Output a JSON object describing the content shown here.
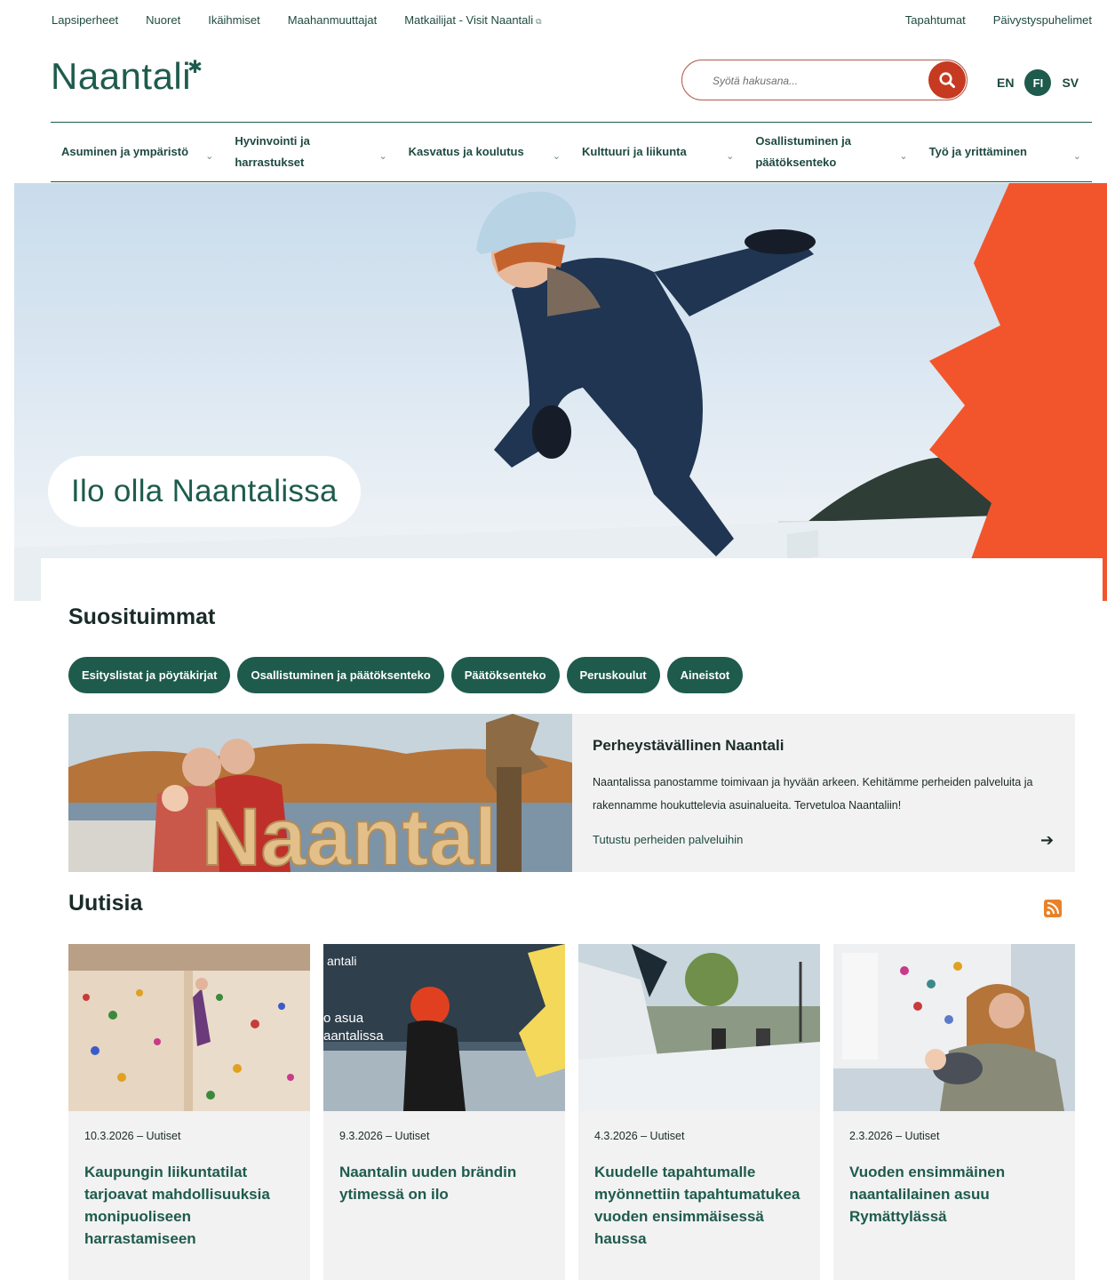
{
  "topnav": {
    "left": [
      "Lapsiperheet",
      "Nuoret",
      "Ikäihmiset",
      "Maahanmuuttajat",
      "Matkailijat - Visit Naantali"
    ],
    "right": [
      "Tapahtumat",
      "Päivystyspuhelimet"
    ]
  },
  "header": {
    "logo": "Naantali",
    "search_placeholder": "Syötä hakusana...",
    "languages": [
      "EN",
      "FI",
      "SV"
    ],
    "active_language": "FI"
  },
  "mainnav": [
    "Asuminen ja ympäristö",
    "Hyvinvointi ja harrastukset",
    "Kasvatus ja koulutus",
    "Kulttuuri ja liikunta",
    "Osallistuminen ja päätöksenteko",
    "Työ ja yrittäminen"
  ],
  "hero": {
    "caption": "Ilo olla Naantalissa"
  },
  "popular": {
    "title": "Suosituimmat",
    "pills": [
      "Esityslistat ja pöytäkirjat",
      "Osallistuminen ja päätöksenteko",
      "Päätöksenteko",
      "Peruskoulut",
      "Aineistot"
    ]
  },
  "feature": {
    "title": "Perheystävällinen Naantali",
    "text": "Naantalissa panostamme toimivaan ja hyvään arkeen. Kehitämme perheiden palveluita ja rakennamme houkuttelevia asuinalueita. Tervetuloa Naantaliin!",
    "link": "Tutustu perheiden palveluihin",
    "image_sign": "Naantali"
  },
  "news": {
    "title": "Uutisia",
    "items": [
      {
        "meta": "10.3.2026 – Uutiset",
        "title": "Kaupungin liikuntatilat tarjoavat mahdollisuuksia monipuoliseen harrastamiseen"
      },
      {
        "meta": "9.3.2026 – Uutiset",
        "title": "Naantalin uuden brändin ytimessä on ilo",
        "overlay": [
          "antali",
          "o asua",
          "aantalissa"
        ]
      },
      {
        "meta": "4.3.2026 – Uutiset",
        "title": "Kuudelle tapahtumalle myönnettiin tapahtumatukea vuoden ensimmäisessä haussa"
      },
      {
        "meta": "2.3.2026 – Uutiset",
        "title": "Vuoden ensimmäinen naantalilainen asuu Rymättylässä"
      }
    ]
  },
  "colors": {
    "brand_green": "#1e5b4c",
    "accent_orange": "#f2552c",
    "search_red": "#c63a21",
    "rss_orange": "#e8822a"
  }
}
